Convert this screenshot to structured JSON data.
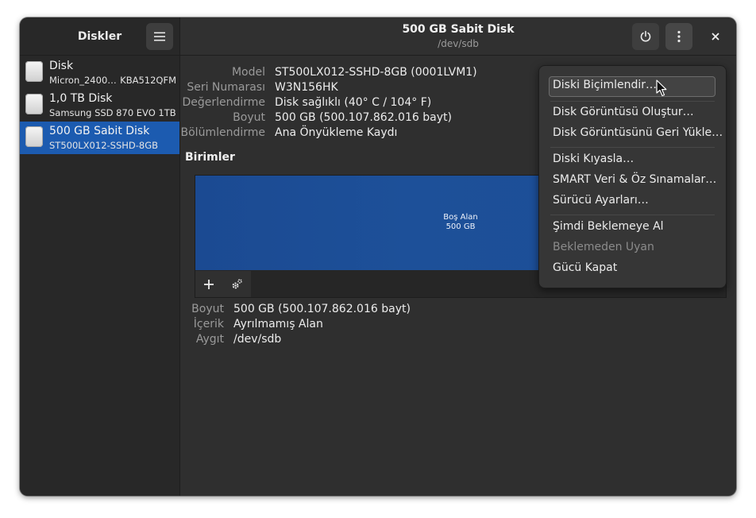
{
  "sidebar_header": {
    "title": "Diskler"
  },
  "header": {
    "title": "500 GB Sabit Disk",
    "subtitle": "/dev/sdb"
  },
  "disks": [
    {
      "name": "Disk",
      "sub": "Micron_2400…",
      "sub_right": "KBA512QFM",
      "selected": false
    },
    {
      "name": "1,0 TB Disk",
      "sub": "Samsung SSD 870 EVO 1TB",
      "selected": false
    },
    {
      "name": "500 GB Sabit Disk",
      "sub": "ST500LX012-SSHD-8GB",
      "selected": true
    }
  ],
  "properties": {
    "model_label": "Model",
    "model": "ST500LX012-SSHD-8GB (0001LVM1)",
    "serial_label": "Seri Numarası",
    "serial": "W3N156HK",
    "assessment_label": "Değerlendirme",
    "assessment": "Disk sağlıklı (40° C / 104° F)",
    "size_label": "Boyut",
    "size": "500 GB (500.107.862.016 bayt)",
    "partitioning_label": "Bölümlendirme",
    "partitioning": "Ana Önyükleme Kaydı"
  },
  "volumes": {
    "title": "Birimler",
    "free_label": "Boş Alan",
    "free_size": "500 GB"
  },
  "volume_details": {
    "size_label": "Boyut",
    "size": "500 GB (500.107.862.016 bayt)",
    "content_label": "İçerik",
    "content": "Ayrılmamış Alan",
    "device_label": "Aygıt",
    "device": "/dev/sdb"
  },
  "menu": {
    "format": "Diski Biçimlendir…",
    "create_image": "Disk Görüntüsü Oluştur…",
    "restore_image": "Disk Görüntüsünü Geri Yükle…",
    "benchmark": "Diski Kıyasla…",
    "smart": "SMART Veri & Öz Sınamalar…",
    "drive_settings": "Sürücü Ayarları…",
    "standby_now": "Şimdi Beklemeye Al",
    "wake_up": "Beklemeden Uyan",
    "power_off": "Gücü Kapat"
  },
  "icons": {
    "hamburger": "hamburger-menu-icon",
    "power": "power-icon",
    "kebab": "kebab-menu-icon",
    "close": "close-icon",
    "add": "plus-icon",
    "settings": "gears-icon",
    "disk": "disk-drive-icon"
  },
  "colors": {
    "accent": "#1c5bb0",
    "volume_fill": "#1c4e9a",
    "window_bg": "#2f2f2f"
  }
}
